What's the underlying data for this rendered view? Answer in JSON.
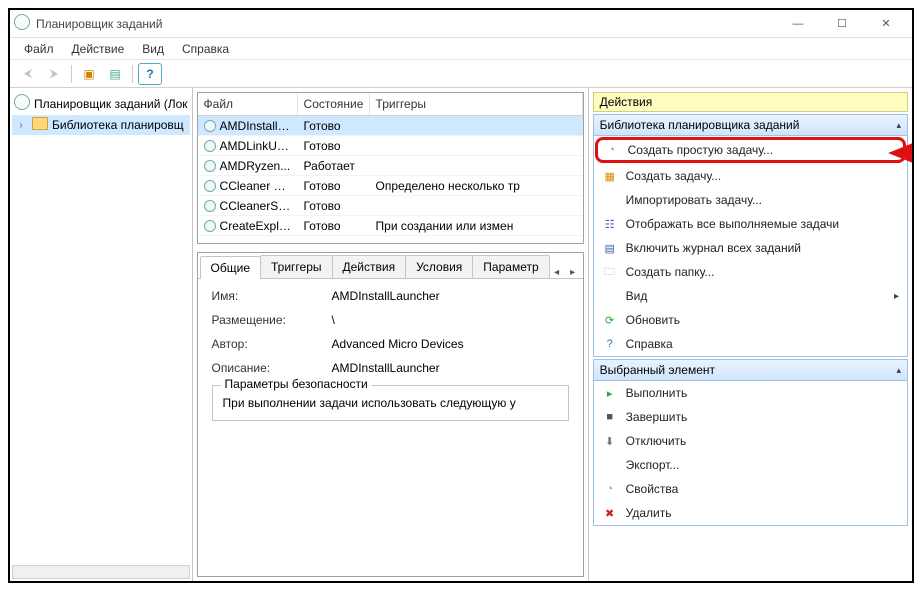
{
  "window": {
    "title": "Планировщик заданий"
  },
  "menu": {
    "file": "Файл",
    "action": "Действие",
    "view": "Вид",
    "help": "Справка"
  },
  "tree": {
    "root": "Планировщик заданий (Лок",
    "child": "Библиотека планировщ"
  },
  "tasks": {
    "headers": {
      "name": "Файл",
      "state": "Состояние",
      "triggers": "Триггеры"
    },
    "rows": [
      {
        "name": "AMDInstallL...",
        "state": "Готово",
        "trigger": ""
      },
      {
        "name": "AMDLinkUp...",
        "state": "Готово",
        "trigger": ""
      },
      {
        "name": "AMDRyzen...",
        "state": "Работает",
        "trigger": ""
      },
      {
        "name": "CCleaner Up...",
        "state": "Готово",
        "trigger": "Определено несколько тр"
      },
      {
        "name": "CCleanerSki...",
        "state": "Готово",
        "trigger": ""
      },
      {
        "name": "CreateExplor...",
        "state": "Готово",
        "trigger": "При создании или измен"
      }
    ]
  },
  "details": {
    "tabs": {
      "general": "Общие",
      "triggers": "Триггеры",
      "actions": "Действия",
      "conditions": "Условия",
      "settings": "Параметр"
    },
    "label_name": "Имя:",
    "name_val": "AMDInstallLauncher",
    "label_location": "Размещение:",
    "location_val": "\\",
    "label_author": "Автор:",
    "author_val": "Advanced Micro Devices",
    "label_desc": "Описание:",
    "desc_val": "AMDInstallLauncher",
    "security_legend": "Параметры безопасности",
    "security_text": "При выполнении задачи использовать следующую у"
  },
  "actions": {
    "pane_title": "Действия",
    "section1": "Библиотека планировщика заданий",
    "items1": [
      {
        "icon": "clock",
        "label": "Создать простую задачу...",
        "hl": true
      },
      {
        "icon": "cal",
        "label": "Создать задачу..."
      },
      {
        "icon": "",
        "label": "Импортировать задачу..."
      },
      {
        "icon": "list",
        "label": "Отображать все выполняемые задачи"
      },
      {
        "icon": "log",
        "label": "Включить журнал всех заданий"
      },
      {
        "icon": "folder",
        "label": "Создать папку..."
      },
      {
        "icon": "",
        "label": "Вид",
        "chev": true
      },
      {
        "icon": "refresh",
        "label": "Обновить"
      },
      {
        "icon": "help",
        "label": "Справка"
      }
    ],
    "section2": "Выбранный элемент",
    "items2": [
      {
        "icon": "run",
        "label": "Выполнить"
      },
      {
        "icon": "stop",
        "label": "Завершить"
      },
      {
        "icon": "disable",
        "label": "Отключить"
      },
      {
        "icon": "",
        "label": "Экспорт..."
      },
      {
        "icon": "clock",
        "label": "Свойства"
      },
      {
        "icon": "delete",
        "label": "Удалить"
      }
    ]
  }
}
